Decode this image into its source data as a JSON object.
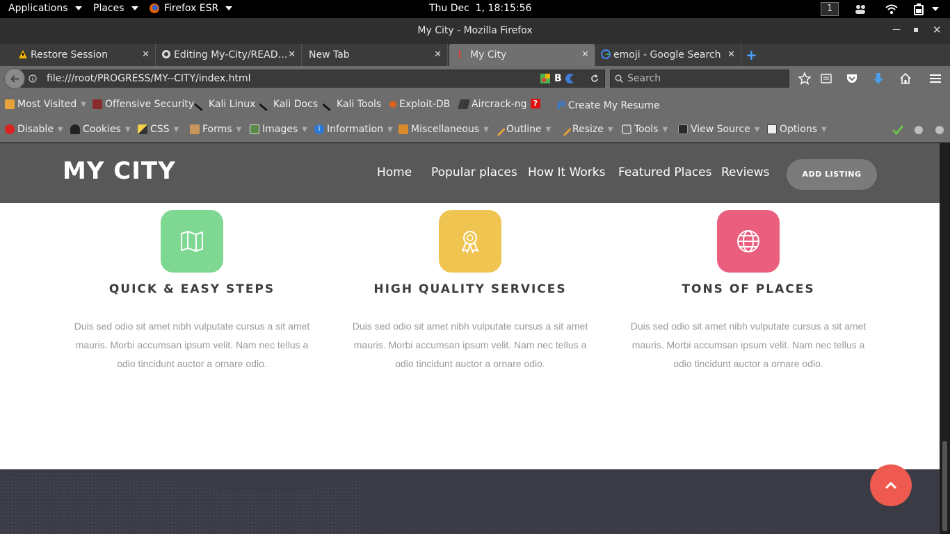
{
  "system_bar": {
    "applications": "Applications",
    "places": "Places",
    "browser": "Firefox ESR",
    "clock": "Thu Dec  1, 18:15:56",
    "workspace": "1"
  },
  "window": {
    "title": "My City - Mozilla Firefox"
  },
  "tabs": [
    {
      "label": "Restore Session",
      "icon": "warning-icon"
    },
    {
      "label": "Editing My-City/READ…",
      "icon": "github-icon"
    },
    {
      "label": "New Tab",
      "icon": ""
    },
    {
      "label": "My City",
      "icon": "page-icon",
      "active": true
    },
    {
      "label": "emoji - Google Search",
      "icon": "google-icon"
    }
  ],
  "navigation": {
    "url": "file:///root/PROGRESS/MY--CITY/index.html",
    "search_placeholder": "Search"
  },
  "bookmarks": [
    "Most Visited",
    "Offensive Security",
    "Kali Linux",
    "Kali Docs",
    "Kali Tools",
    "Exploit-DB",
    "Aircrack-ng",
    "Create My Resume"
  ],
  "webdev_toolbar": [
    "Disable",
    "Cookies",
    "CSS",
    "Forms",
    "Images",
    "Information",
    "Miscellaneous",
    "Outline",
    "Resize",
    "Tools",
    "View Source",
    "Options"
  ],
  "site": {
    "logo": "MY CITY",
    "nav": [
      "Home",
      "Popular places",
      "How It Works",
      "Featured Places",
      "Reviews"
    ],
    "cta": "ADD LISTING",
    "features": [
      {
        "title": "QUICK & EASY STEPS",
        "text": "Duis sed odio sit amet nibh vulputate cursus a sit amet mauris. Morbi accumsan ipsum velit. Nam nec tellus a odio tincidunt auctor a ornare odio.",
        "color": "#7ed891",
        "icon": "map-icon"
      },
      {
        "title": "HIGH QUALITY SERVICES",
        "text": "Duis sed odio sit amet nibh vulputate cursus a sit amet mauris. Morbi accumsan ipsum velit. Nam nec tellus a odio tincidunt auctor a ornare odio.",
        "color": "#f0c450",
        "icon": "award-icon"
      },
      {
        "title": "TONS OF PLACES",
        "text": "Duis sed odio sit amet nibh vulputate cursus a sit amet mauris. Morbi accumsan ipsum velit. Nam nec tellus a odio tincidunt auctor a ornare odio.",
        "color": "#ea5f7d",
        "icon": "globe-icon"
      }
    ],
    "back_to_top_color": "#ee5a4f"
  }
}
